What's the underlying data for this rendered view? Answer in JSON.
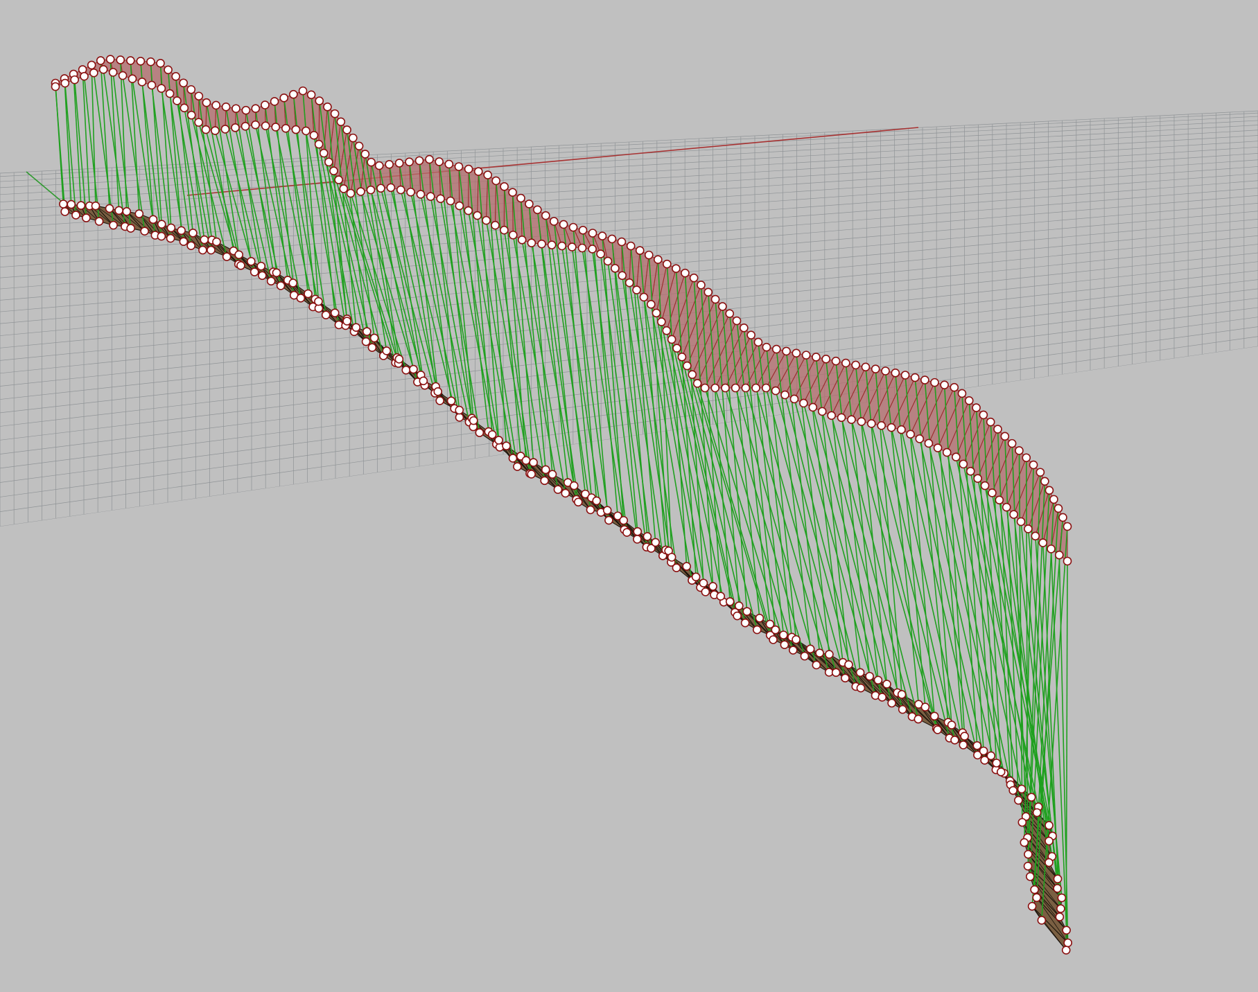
{
  "viewport": {
    "background_color": "#c0c0c0",
    "grid_color": "#8f9396",
    "x_axis_color": "#a83232",
    "y_axis_color": "#2f9a2f"
  },
  "model": {
    "elevated_surface_fill": "#b46e6e",
    "elevated_edge_color": "#9a2a2a",
    "ground_surface_fill": "#7a5f42",
    "ground_edge_color": "#1c140c",
    "connector_color": "#1fa01f",
    "control_point_fill": "#ffffff",
    "control_point_stroke": "#8a1010"
  }
}
